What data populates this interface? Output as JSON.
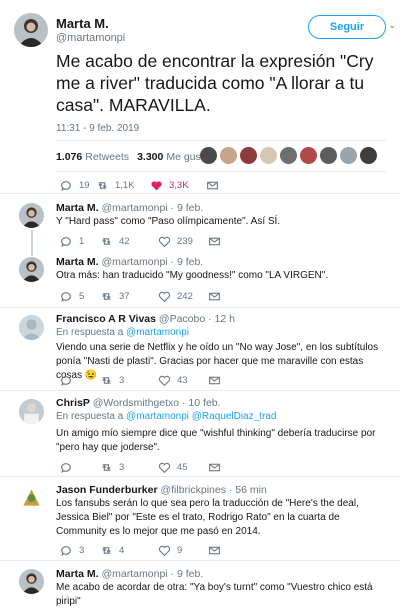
{
  "main_tweet": {
    "author_name": "Marta M.",
    "author_handle": "@martamonpi",
    "follow_label": "Seguir",
    "text": "Me acabo de encontrar la expresión \"Cry me a river\" traducida como \"A llorar a tu casa\". MARAVILLA.",
    "timestamp": "11:31 - 9 feb. 2019",
    "retweets_count": "1.076",
    "retweets_label": "Retweets",
    "likes_count": "3.300",
    "likes_label": "Me gusta",
    "replies": "19",
    "retweets_short": "1,1K",
    "likes_short": "3,3K"
  },
  "replies": [
    {
      "name": "Marta M.",
      "handle": "@martamonpi · 9 feb.",
      "text": "Y \"Hard pass\" como \"Paso olímpicamente\". Así SÍ.",
      "replies": "1",
      "retweets": "42",
      "likes": "239"
    },
    {
      "name": "Marta M.",
      "handle": "@martamonpi · 9 feb.",
      "text": "Otra más: han traducido \"My goodness!\" como \"LA VIRGEN\".",
      "replies": "5",
      "retweets": "37",
      "likes": "242"
    },
    {
      "name": "Francisco A R Vivas",
      "handle": "@Pacobo · 12 h",
      "reply_to_prefix": "En respuesta a ",
      "reply_to": "@martamonpi",
      "text": "Viendo una serie de Netflix y he oído un \"No way Jose\", en los subtítulos ponía \"Nasti de plasti\". Gracias por hacer que me maraville con estas cosas 😉",
      "replies": "",
      "retweets": "3",
      "likes": "43"
    },
    {
      "name": "ChrisP",
      "handle": "@Wordsmithgetxo · 10 feb.",
      "reply_to_prefix": "En respuesta a ",
      "reply_to": "@martamonpi @RaquelDiaz_trad",
      "text": "Un amigo mío siempre dice que \"wishful thinking\" debería traducirse por \"pero hay que joderse\".",
      "replies": "",
      "retweets": "3",
      "likes": "45"
    },
    {
      "name": "Jason Funderburker",
      "handle": "@filbrickpines · 56 min",
      "text": "Los fansubs serán lo que sea pero la traducción de \"Here's the deal, Jessica Biel\" por \"Este es el trato, Rodrigo Rato\" en la cuarta de Community es lo mejor que me pasó en 2014.",
      "replies": "3",
      "retweets": "4",
      "likes": "9"
    },
    {
      "name": "Marta M.",
      "handle": "@martamonpi · 9 feb.",
      "text": "Me acabo de acordar de otra: \"Ya boy's turnt\" como \"Vuestro chico está piripi\""
    }
  ],
  "colors": {
    "accent": "#1da1f2",
    "like": "#e0245e",
    "muted": "#657786",
    "divider": "#e6ecf0"
  }
}
